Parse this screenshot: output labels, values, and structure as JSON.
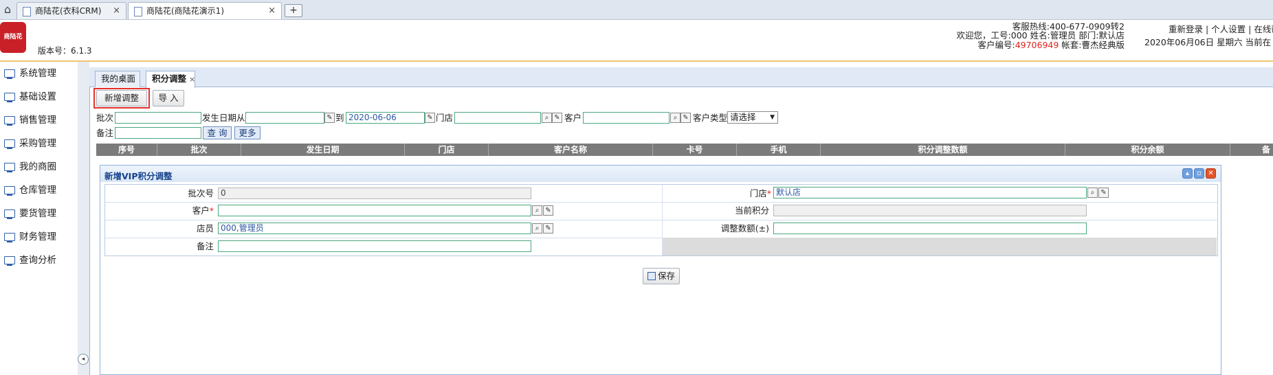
{
  "browser": {
    "tabs": [
      {
        "label": "商陆花(衣科CRM)",
        "active": false
      },
      {
        "label": "商陆花(商陆花演示1)",
        "active": true
      }
    ],
    "new_tab": "+",
    "close": "×"
  },
  "header": {
    "logo_text": "商陆花",
    "version": "版本号：6.1.3",
    "hotline": "客服热线:400-677-0909转2",
    "welcome": "欢迎您，工号:000 姓名:管理员 部门:默认店",
    "customer_no_label": "客户编号:",
    "customer_no": "49706949",
    "package": " 帐套:曹杰经典版",
    "links": "重新登录 | 个人设置 | 在线帮",
    "date": "2020年06月06日 星期六 当前在"
  },
  "sidebar": {
    "items": [
      {
        "label": "系统管理"
      },
      {
        "label": "基础设置"
      },
      {
        "label": "销售管理"
      },
      {
        "label": "采购管理"
      },
      {
        "label": "我的商圈"
      },
      {
        "label": "仓库管理"
      },
      {
        "label": "要货管理"
      },
      {
        "label": "财务管理"
      },
      {
        "label": "查询分析"
      }
    ],
    "collapse": "◂"
  },
  "page_tabs": {
    "desktop": "我的桌面",
    "points": "积分调整",
    "close": "×"
  },
  "toolbar": {
    "add": "新增调整",
    "import": "导 入"
  },
  "filters": {
    "batch": "批次",
    "date_from": "发生日期从",
    "to": "到",
    "date_to_value": "2020-06-06",
    "store": "门店",
    "customer": "客户",
    "customer_type": "客户类型",
    "customer_type_value": "请选择",
    "remark": "备注",
    "query": "查 询",
    "more": "更多"
  },
  "table": {
    "columns": [
      "序号",
      "批次",
      "发生日期",
      "门店",
      "客户名称",
      "卡号",
      "手机",
      "积分调整数额",
      "积分余额",
      "备"
    ]
  },
  "dialog": {
    "title": "新增VIP积分调整",
    "batch_no_label": "批次号",
    "batch_no_value": "0",
    "store_label": "门店",
    "store_value": "默认店",
    "customer_label": "客户",
    "current_points_label": "当前积分",
    "clerk_label": "店员",
    "clerk_value": "000,管理员",
    "adjust_label": "调整数额(±)",
    "remark_label": "备注",
    "required": "*",
    "save": "保存"
  },
  "colors": {
    "accent_red": "#e0231d",
    "header_rule": "#f0c46c",
    "dialog_title": "#15428b",
    "input_border": "#4aa77e"
  }
}
